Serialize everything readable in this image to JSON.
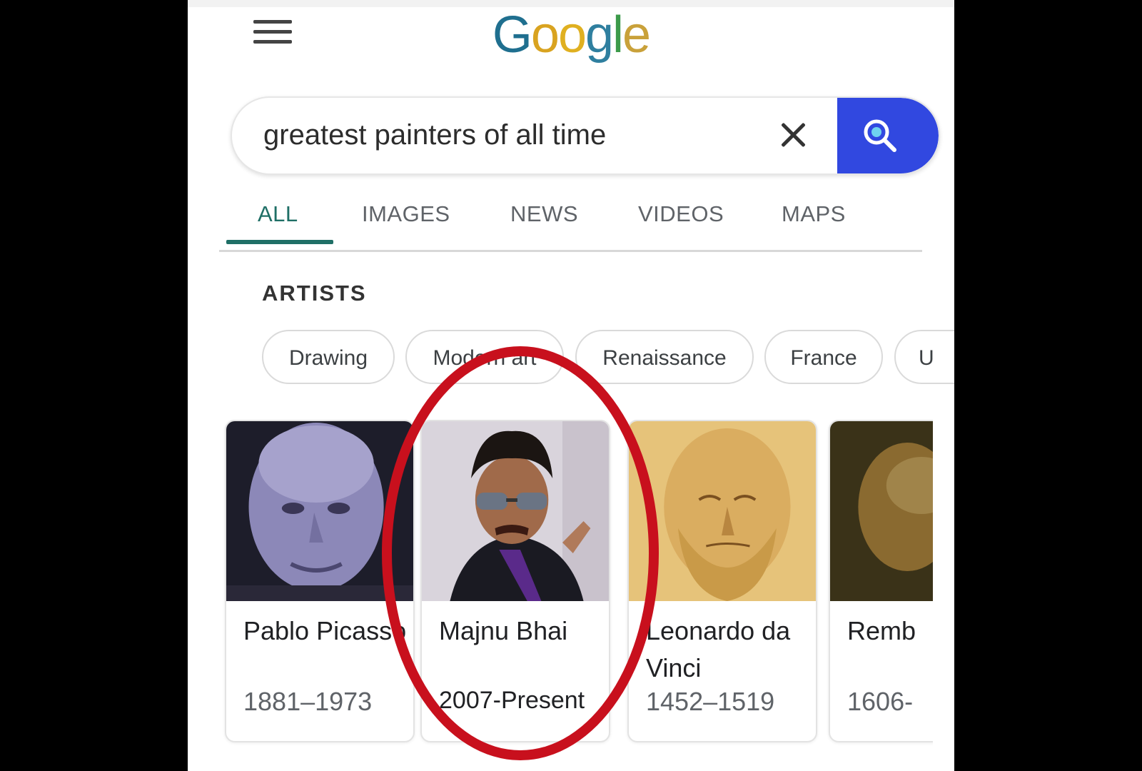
{
  "logo": {
    "letters": [
      "G",
      "o",
      "o",
      "g",
      "l",
      "e"
    ],
    "colors": [
      "#1f6f8f",
      "#d9a320",
      "#e0b020",
      "#2f7f9f",
      "#3c9a4a",
      "#c9a13a"
    ]
  },
  "search": {
    "query": "greatest painters of all time",
    "accent": "#3148e0"
  },
  "tabs": [
    {
      "label": "ALL",
      "active": true
    },
    {
      "label": "IMAGES"
    },
    {
      "label": "NEWS"
    },
    {
      "label": "VIDEOS"
    },
    {
      "label": "MAPS"
    }
  ],
  "section": {
    "title": "ARTISTS"
  },
  "chips": [
    "Drawing",
    "Modern art",
    "Renaissance",
    "France",
    "U"
  ],
  "artists": [
    {
      "name": "Pablo Picasso",
      "years": "1881–1973"
    },
    {
      "name": "Majnu Bhai",
      "years": "2007-Present"
    },
    {
      "name": "Leonardo da Vinci",
      "years": "1452–1519"
    },
    {
      "name": "Remb",
      "years": "1606-"
    }
  ],
  "highlight_color": "#c8101d"
}
